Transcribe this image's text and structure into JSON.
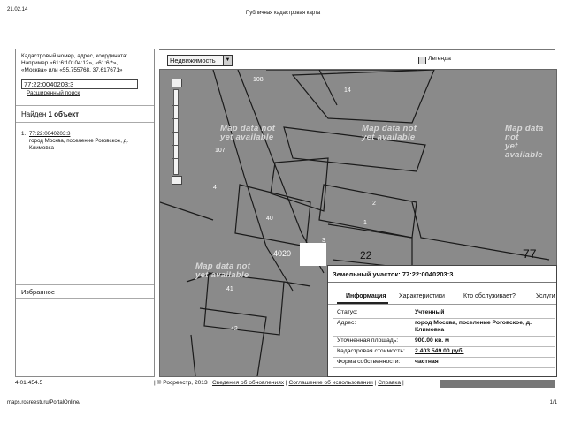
{
  "print": {
    "date": "21.02.14",
    "title": "Публичная кадастровая карта",
    "url": "maps.rosreestr.ru/PortalOnline/",
    "page": "1/1"
  },
  "search": {
    "help_line1": "Кадастровый номер, адрес, координата:",
    "help_line2": "Например «61:6:10104:12», «61:6:*»,",
    "help_line3": "«Москва» или «55.755768, 37.617671»",
    "value": "77:22:0040203:3",
    "advanced_label": "Расширенный поиск"
  },
  "results": {
    "found_prefix": "Найден",
    "found_count": "1 объект",
    "items": [
      {
        "num": "1.",
        "cadastral": "77:22:0040203:3",
        "address": "город Москва, поселение Роговское, д. Климовка"
      }
    ]
  },
  "favorites": {
    "title": "Избранное"
  },
  "toolbar": {
    "layer_select": "Недвижимость",
    "legend_label": "Легенда"
  },
  "map": {
    "watermark_line1": "Map data not",
    "watermark_line2": "yet available",
    "labels": [
      "108",
      "14",
      "107",
      "40",
      "1",
      "2",
      "4",
      "42",
      "4020",
      "22",
      "77",
      "41",
      "3"
    ]
  },
  "popup": {
    "title": "Земельный участок: 77:22:0040203:3",
    "tabs": [
      "Информация",
      "Характеристики",
      "Кто обслуживает?",
      "Услуги"
    ],
    "rows": [
      {
        "label": "Статус:",
        "value": "Учтенный"
      },
      {
        "label": "Адрес:",
        "value": "город Москва, поселение Роговское, д. Климовка"
      },
      {
        "label": "Уточненная площадь:",
        "value": "900.00 кв. м"
      },
      {
        "label": "Кадастровая стоимость:",
        "value": "2 403 549.00 руб."
      },
      {
        "label": "Форма собственности:",
        "value": "частная"
      }
    ]
  },
  "status": {
    "version": "4.01.454.5",
    "copyright": "| © Росреестр, 2013 |",
    "link_updates": "Сведения об обновлениях",
    "link_terms": "Соглашение об использовании",
    "link_help": "Справка"
  }
}
